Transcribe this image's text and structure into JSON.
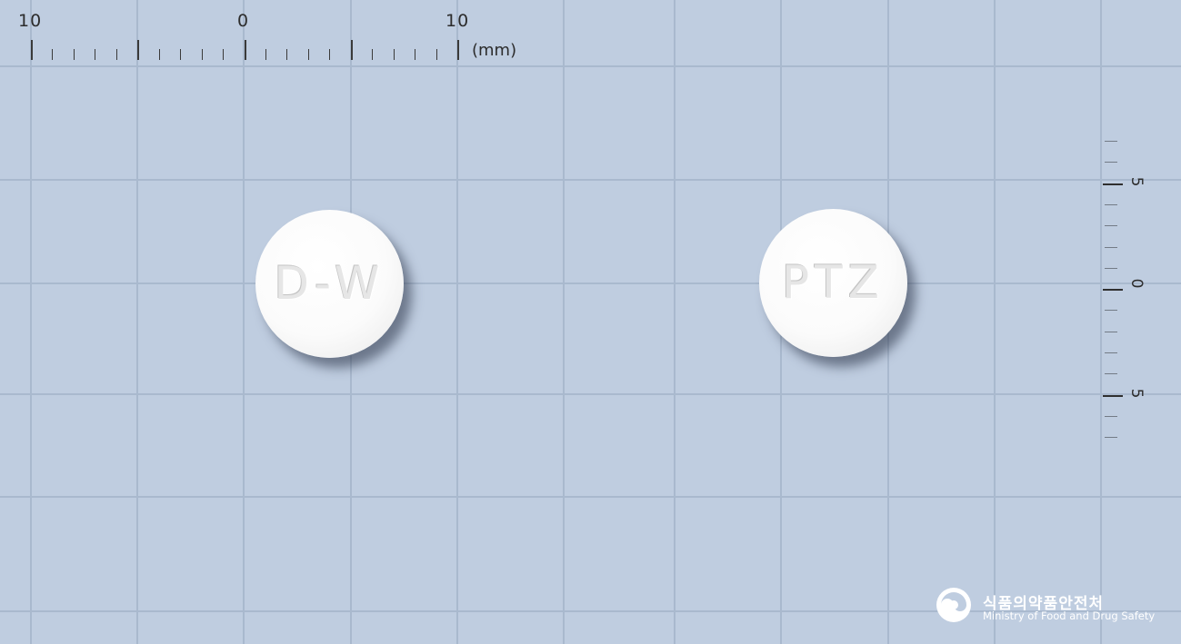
{
  "ruler_top": {
    "labels": [
      "10",
      "0",
      "10"
    ],
    "unit": "(mm)"
  },
  "ruler_right": {
    "labels": [
      "5",
      "0",
      "5"
    ]
  },
  "tablets": [
    {
      "imprint": "D-W",
      "color": "#ffffff",
      "shape": "round"
    },
    {
      "imprint": "PTZ",
      "color": "#ffffff",
      "shape": "round"
    }
  ],
  "watermark": {
    "korean": "식품의약품안전처",
    "english": "Ministry of Food and Drug Safety"
  },
  "colors": {
    "background": "#bfcde0",
    "grid": "#a9b9ce"
  }
}
